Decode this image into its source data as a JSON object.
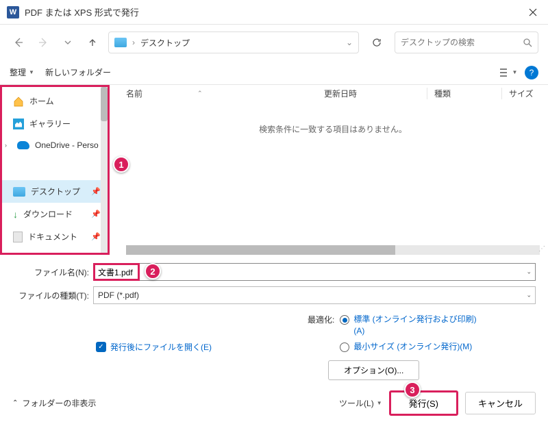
{
  "title": "PDF または XPS 形式で発行",
  "breadcrumb": {
    "location": "デスクトップ"
  },
  "search": {
    "placeholder": "デスクトップの検索"
  },
  "toolbar": {
    "organize": "整理",
    "newfolder": "新しいフォルダー"
  },
  "sidebar": {
    "home": "ホーム",
    "gallery": "ギャラリー",
    "onedrive": "OneDrive - Perso",
    "desktop": "デスクトップ",
    "downloads": "ダウンロード",
    "documents": "ドキュメント"
  },
  "columns": {
    "name": "名前",
    "date": "更新日時",
    "type": "種類",
    "size": "サイズ"
  },
  "empty": "検索条件に一致する項目はありません。",
  "form": {
    "filename_label": "ファイル名(N):",
    "filename_value": "文書1.pdf",
    "filetype_label": "ファイルの種類(T):",
    "filetype_value": "PDF (*.pdf)"
  },
  "options": {
    "open_after": "発行後にファイルを開く(E)",
    "optimize_label": "最適化:",
    "standard": "標準 (オンライン発行および印刷)(A)",
    "minsize": "最小サイズ (オンライン発行)(M)",
    "options_btn": "オプション(O)..."
  },
  "footer": {
    "hide_folders": "フォルダーの非表示",
    "tools": "ツール(L)",
    "publish": "発行(S)",
    "cancel": "キャンセル"
  },
  "callouts": {
    "c1": "1",
    "c2": "2",
    "c3": "3"
  }
}
